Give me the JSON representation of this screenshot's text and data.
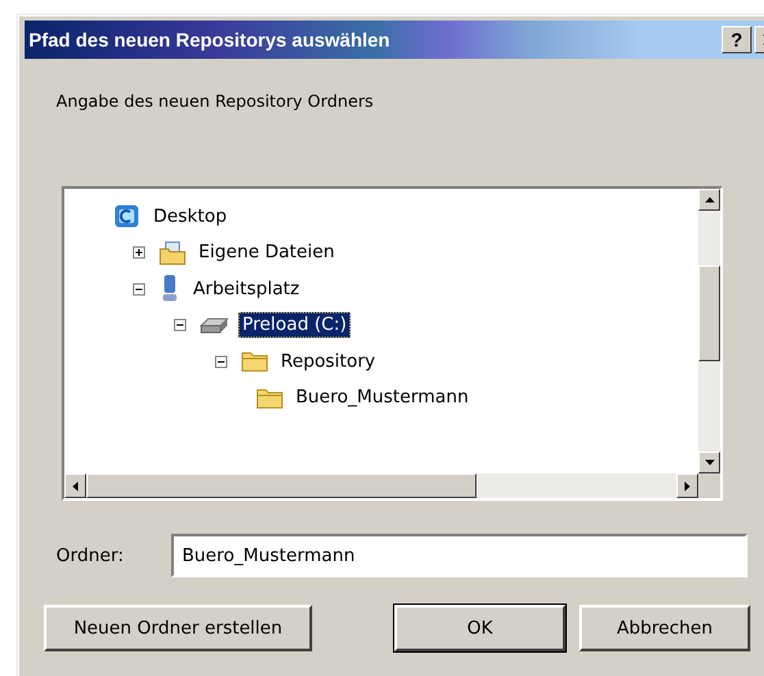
{
  "window": {
    "title": "Pfad des neuen Repositorys auswählen",
    "help_button": "?"
  },
  "prompt": "Angabe des neuen Repository Ordners",
  "tree": [
    {
      "label": "Desktop",
      "kind": "desktop",
      "selected": false,
      "children": [
        {
          "label": "Eigene Dateien",
          "kind": "documents",
          "expanded": false,
          "selected": false
        },
        {
          "label": "Arbeitsplatz",
          "kind": "computer",
          "expanded": true,
          "selected": false,
          "children": [
            {
              "label": "Preload (C:)",
              "kind": "drive",
              "expanded": true,
              "selected": true,
              "children": [
                {
                  "label": "Repository",
                  "kind": "folder",
                  "expanded": true,
                  "selected": false,
                  "children": [
                    {
                      "label": "Buero_Mustermann",
                      "kind": "folder",
                      "selected": false
                    }
                  ]
                }
              ]
            }
          ]
        }
      ]
    }
  ],
  "folder_field": {
    "label": "Ordner:",
    "value": "Buero_Mustermann"
  },
  "buttons": [
    {
      "label": "Neuen Ordner erstellen",
      "default": false
    },
    {
      "label": "OK",
      "default": true
    },
    {
      "label": "Abbrechen",
      "default": false
    }
  ]
}
